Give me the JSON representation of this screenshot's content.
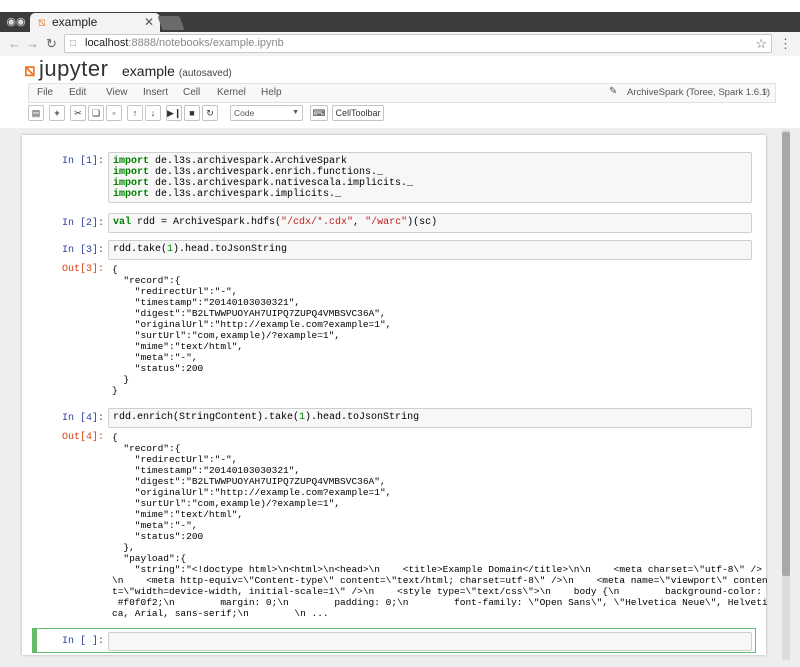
{
  "browser": {
    "tab_title": "example",
    "url_host": "localhost",
    "url_path": ":8888/notebooks/example.ipynb"
  },
  "jupyter": {
    "logo_text": "jupyter",
    "notebook_name": "example",
    "save_status": "(autosaved)",
    "menu": [
      "File",
      "Edit",
      "View",
      "Insert",
      "Cell",
      "Kernel",
      "Help"
    ],
    "kernel_name": "ArchiveSpark (Toree, Spark 1.6.1)",
    "cell_type": "Code",
    "celltoolbar_label": "CellToolbar"
  },
  "cells": {
    "c1": {
      "prompt": "In [1]:",
      "lines": [
        [
          "import",
          " de.l3s.archivespark.ArchiveSpark"
        ],
        [
          "import",
          " de.l3s.archivespark.enrich.functions._"
        ],
        [
          "import",
          " de.l3s.archivespark.nativescala.implicits._"
        ],
        [
          "import",
          " de.l3s.archivespark.implicits._"
        ]
      ]
    },
    "c2": {
      "prompt": "In [2]:",
      "kw": "val",
      "a": " rdd = ArchiveSpark.hdfs(",
      "s1": "\"/cdx/*.cdx\"",
      "b": ", ",
      "s2": "\"/warc\"",
      "c": ")(sc)"
    },
    "c3": {
      "prompt": "In [3]:",
      "a": "rdd.take(",
      "n": "1",
      "b": ").head.toJsonString",
      "out_prompt": "Out[3]:",
      "output": "{\n  \"record\":{\n    \"redirectUrl\":\"-\",\n    \"timestamp\":\"20140103030321\",\n    \"digest\":\"B2LTWWPUOYAH7UIPQ7ZUPQ4VMBSVC36A\",\n    \"originalUrl\":\"http://example.com?example=1\",\n    \"surtUrl\":\"com,example)/?example=1\",\n    \"mime\":\"text/html\",\n    \"meta\":\"-\",\n    \"status\":200\n  }\n}"
    },
    "c4": {
      "prompt": "In [4]:",
      "a": "rdd.enrich(StringContent).take(",
      "n": "1",
      "b": ").head.toJsonString",
      "out_prompt": "Out[4]:",
      "output": "{\n  \"record\":{\n    \"redirectUrl\":\"-\",\n    \"timestamp\":\"20140103030321\",\n    \"digest\":\"B2LTWWPUOYAH7UIPQ7ZUPQ4VMBSVC36A\",\n    \"originalUrl\":\"http://example.com?example=1\",\n    \"surtUrl\":\"com,example)/?example=1\",\n    \"mime\":\"text/html\",\n    \"meta\":\"-\",\n    \"status\":200\n  },\n  \"payload\":{\n    \"string\":\"<!doctype html>\\n<html>\\n<head>\\n    <title>Example Domain</title>\\n\\n    <meta charset=\\\"utf-8\\\" />\n\\n    <meta http-equiv=\\\"Content-type\\\" content=\\\"text/html; charset=utf-8\\\" />\\n    <meta name=\\\"viewport\\\" conten\nt=\\\"width=device-width, initial-scale=1\\\" />\\n    <style type=\\\"text/css\\\">\\n    body {\\n        background-color:\n #f0f0f2;\\n        margin: 0;\\n        padding: 0;\\n        font-family: \\\"Open Sans\\\", \\\"Helvetica Neue\\\", Helveti\nca, Arial, sans-serif;\\n        \\n ..."
    },
    "c5": {
      "prompt": "In [ ]:"
    }
  }
}
